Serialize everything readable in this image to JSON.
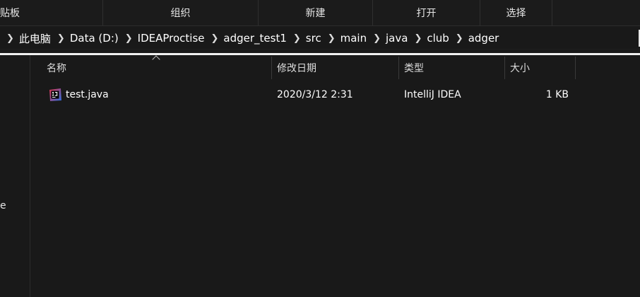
{
  "ribbon": {
    "groups": [
      "贴板",
      "组织",
      "新建",
      "打开",
      "选择"
    ]
  },
  "addressbar": {
    "crumbs": [
      "此电脑",
      "Data (D:)",
      "IDEAProctise",
      "adger_test1",
      "src",
      "main",
      "java",
      "club",
      "adger"
    ]
  },
  "navpane": {
    "fragment": "e"
  },
  "columns": {
    "name": "名称",
    "modified": "修改日期",
    "type": "类型",
    "size": "大小"
  },
  "files": [
    {
      "name": "test.java",
      "modified": "2020/3/12 2:31",
      "type": "IntelliJ IDEA",
      "size": "1 KB",
      "icon": "intellij-java-file-icon"
    }
  ],
  "colors": {
    "background": "#191919",
    "accent_line": "#f0f0f0",
    "icon_red": "#e0324a",
    "icon_blue": "#2f6fe0"
  }
}
